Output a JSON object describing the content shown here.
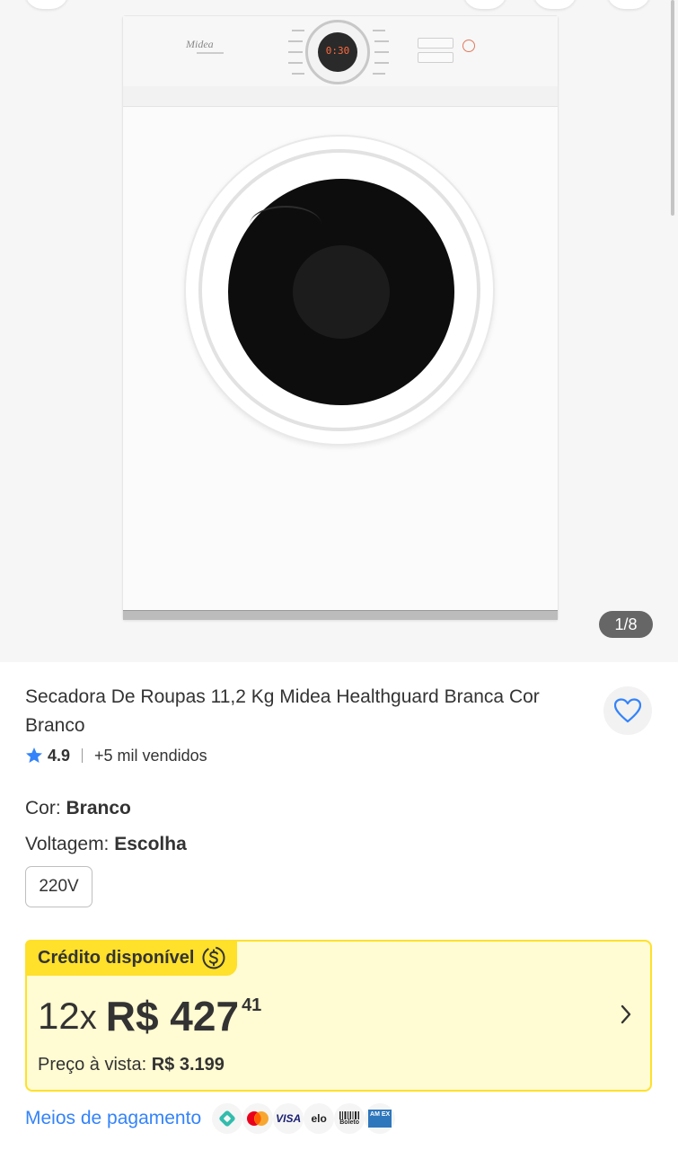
{
  "gallery": {
    "counter": "1/8",
    "image_alt": "Secadora de roupas Midea branca",
    "panel_brand": "Midea",
    "panel_display": "0:30"
  },
  "product": {
    "title": "Secadora De Roupas 11,2 Kg Midea Healthguard Branca Cor Branco",
    "rating": "4.9",
    "sold": "+5 mil vendidos"
  },
  "attributes": {
    "color_label": "Cor: ",
    "color_value": "Branco",
    "voltage_label": "Voltagem: ",
    "voltage_value": "Escolha",
    "voltage_option": "220V"
  },
  "credit": {
    "tag": "Crédito disponível",
    "installments": "12",
    "times": "x",
    "amount": "R$ 427",
    "cents": "41",
    "cash_label": "Preço à vista: ",
    "cash_value": "R$ 3.199"
  },
  "payment": {
    "link": "Meios de pagamento",
    "methods": [
      "pix-icon",
      "mastercard-icon",
      "visa-icon",
      "elo-icon",
      "boleto-icon",
      "amex-icon"
    ],
    "visa_label": "VISA",
    "elo_label": "elo",
    "boleto_label": "Boleto",
    "amex_label": "AM EX"
  },
  "colors": {
    "accent_blue": "#3483fa",
    "credit_yellow": "#ffe02b",
    "credit_bg": "#fffbd2"
  }
}
